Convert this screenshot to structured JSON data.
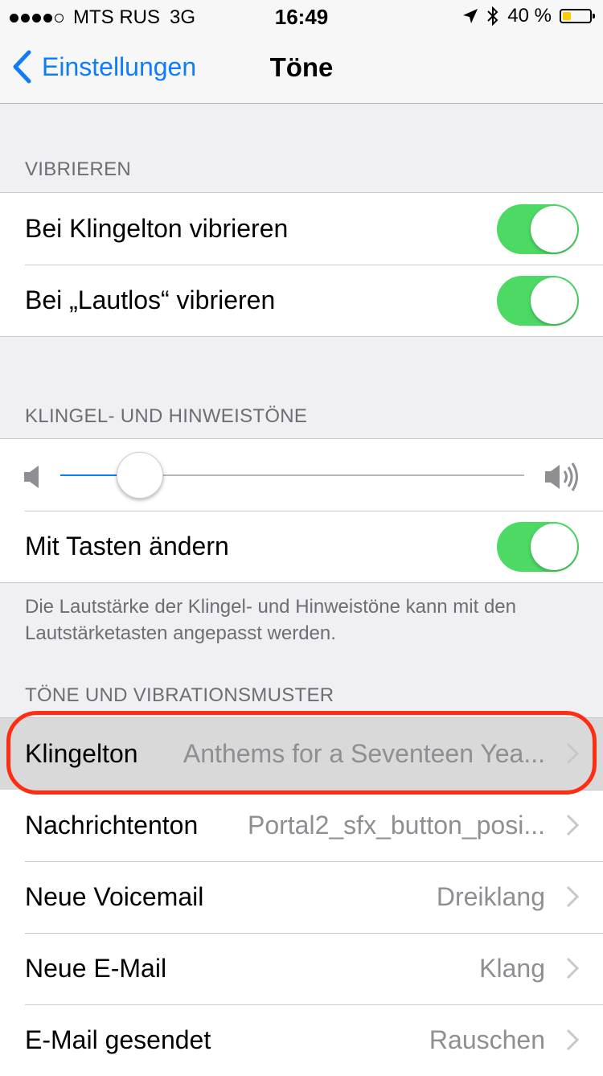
{
  "status_bar": {
    "carrier": "MTS RUS",
    "network": "3G",
    "time": "16:49",
    "battery_percent": "40 %",
    "signal_bars_filled": 4,
    "signal_bars_total": 5,
    "battery_level": 0.4,
    "battery_color": "#ffcc00"
  },
  "nav": {
    "back_label": "Einstellungen",
    "title": "Töne"
  },
  "sections": {
    "vibration": {
      "header": "VIBRIEREN",
      "rows": [
        {
          "label": "Bei Klingelton vibrieren",
          "on": true
        },
        {
          "label": "Bei „Lautlos“ vibrieren",
          "on": true
        }
      ]
    },
    "ringer": {
      "header": "KLINGEL- UND HINWEISTÖNE",
      "volume_level": 0.17,
      "change_with_buttons_label": "Mit Tasten ändern",
      "change_with_buttons_on": true,
      "footer": "Die Lautstärke der Klingel- und Hinweistöne kann mit den Lautstärketasten angepasst werden."
    },
    "tones": {
      "header": "TÖNE UND VIBRATIONSMUSTER",
      "rows": [
        {
          "label": "Klingelton",
          "value": "Anthems for a Seventeen Yea..."
        },
        {
          "label": "Nachrichtenton",
          "value": "Portal2_sfx_button_posi..."
        },
        {
          "label": "Neue Voicemail",
          "value": "Dreiklang"
        },
        {
          "label": "Neue E-Mail",
          "value": "Klang"
        },
        {
          "label": "E-Mail gesendet",
          "value": "Rauschen"
        }
      ]
    }
  },
  "colors": {
    "accent": "#0f7dfb",
    "toggle_on": "#4cd964",
    "highlight_ring": "#ff2d14"
  }
}
